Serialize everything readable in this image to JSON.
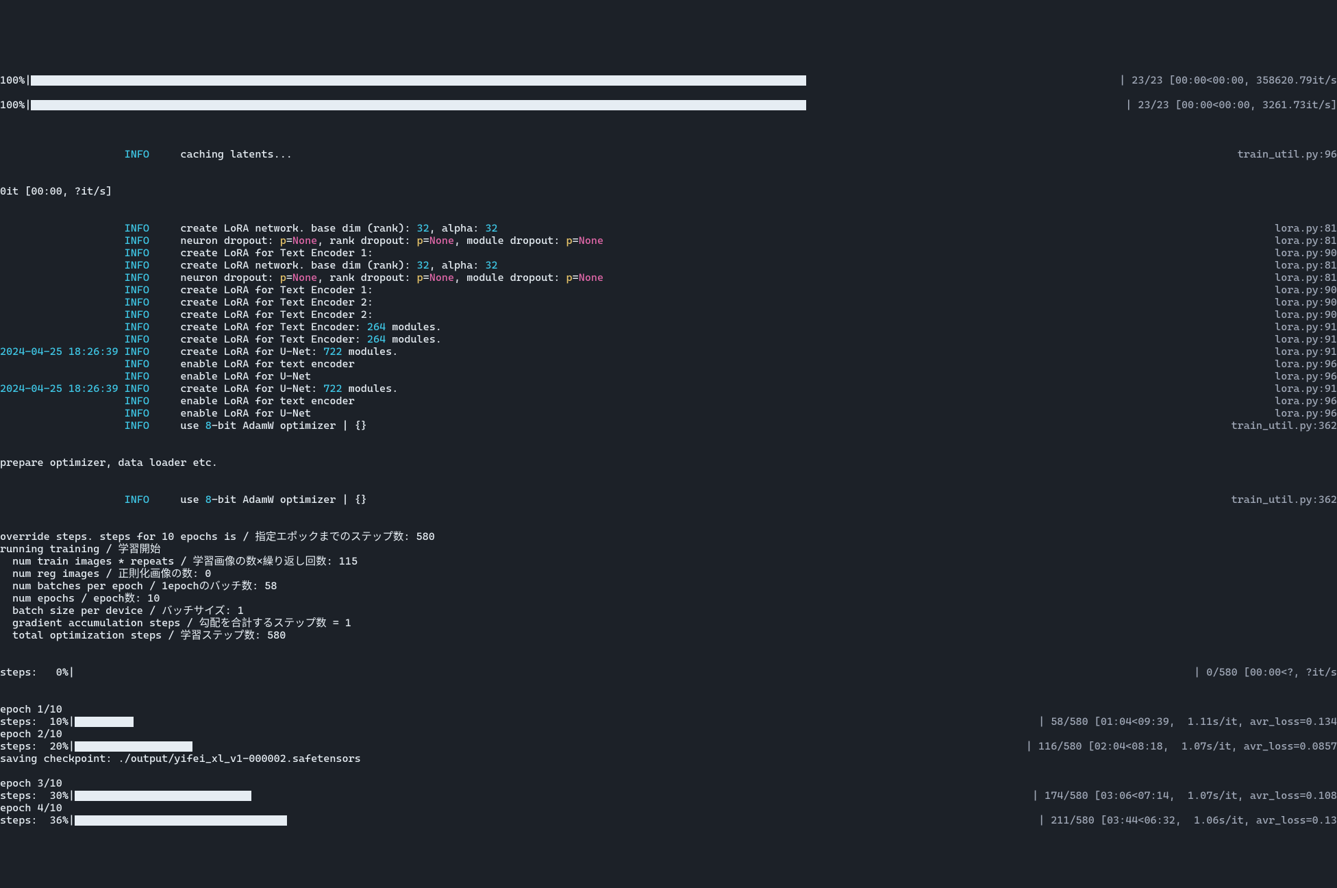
{
  "bars": {
    "b1": {
      "label": "100%|",
      "right": "| 23/23 [00:00<00:00, 358620.79it/s"
    },
    "b2": {
      "label": "100%|",
      "right": "| 23/23 [00:00<00:00, 3261.73it/s]"
    }
  },
  "log1": {
    "info": "INFO",
    "msg": "caching latents...",
    "right": "train_util.py:96"
  },
  "zeroit": "0it [00:00, ?it/s]",
  "rows": [
    {
      "ts": "",
      "info": "INFO",
      "msg": "create LoRA network. base dim (rank): ",
      "n1": "32",
      "mid": ", alpha: ",
      "n2": "32",
      "right": "lora.py:81"
    },
    {
      "ts": "",
      "info": "INFO",
      "msg": "neuron dropout: ",
      "right": "lora.py:81",
      "dropout": true
    },
    {
      "ts": "",
      "info": "INFO",
      "msg": "create LoRA for Text Encoder 1:",
      "right": "lora.py:90"
    },
    {
      "ts": "",
      "info": "INFO",
      "msg": "create LoRA network. base dim (rank): ",
      "n1": "32",
      "mid": ", alpha: ",
      "n2": "32",
      "right": "lora.py:81"
    },
    {
      "ts": "",
      "info": "INFO",
      "msg": "neuron dropout: ",
      "right": "lora.py:81",
      "dropout": true
    },
    {
      "ts": "",
      "info": "INFO",
      "msg": "create LoRA for Text Encoder 1:",
      "right": "lora.py:90"
    },
    {
      "ts": "",
      "info": "INFO",
      "msg": "create LoRA for Text Encoder 2:",
      "right": "lora.py:90"
    },
    {
      "ts": "",
      "info": "INFO",
      "msg": "create LoRA for Text Encoder 2:",
      "right": "lora.py:90"
    },
    {
      "ts": "",
      "info": "INFO",
      "msg": "create LoRA for Text Encoder: ",
      "n1": "264",
      "mid": " modules.",
      "right": "lora.py:91"
    },
    {
      "ts": "",
      "info": "INFO",
      "msg": "create LoRA for Text Encoder: ",
      "n1": "264",
      "mid": " modules.",
      "right": "lora.py:91"
    },
    {
      "ts": "2024-04-25 18:26:39",
      "info": "INFO",
      "msg": "create LoRA for U-Net: ",
      "n1": "722",
      "mid": " modules.",
      "right": "lora.py:91"
    },
    {
      "ts": "",
      "info": "INFO",
      "msg": "enable LoRA for text encoder",
      "right": "lora.py:96"
    },
    {
      "ts": "",
      "info": "INFO",
      "msg": "enable LoRA for U-Net",
      "right": "lora.py:96"
    },
    {
      "ts": "2024-04-25 18:26:39",
      "info": "INFO",
      "msg": "create LoRA for U-Net: ",
      "n1": "722",
      "mid": " modules.",
      "right": "lora.py:91"
    },
    {
      "ts": "",
      "info": "INFO",
      "msg": "enable LoRA for text encoder",
      "right": "lora.py:96"
    },
    {
      "ts": "",
      "info": "INFO",
      "msg": "enable LoRA for U-Net",
      "right": "lora.py:96"
    },
    {
      "ts": "",
      "info": "INFO",
      "msg_numprefix": "use ",
      "n1": "8",
      "msg_numsuffix": "-bit AdamW optimizer | {}",
      "right": "train_util.py:362"
    }
  ],
  "prep": "prepare optimizer, data loader etc.",
  "row_opt2": {
    "info": "INFO",
    "msg_numprefix": "use ",
    "n1": "8",
    "msg_numsuffix": "-bit AdamW optimizer | {}",
    "right": "train_util.py:362"
  },
  "plain": [
    "override steps. steps for 10 epochs is / 指定エポックまでのステップ数: 580",
    "running training / 学習開始",
    "  num train images * repeats / 学習画像の数×繰り返し回数: 115",
    "  num reg images / 正則化画像の数: 0",
    "  num batches per epoch / 1epochのバッチ数: 58",
    "  num epochs / epoch数: 10",
    "  batch size per device / バッチサイズ: 1",
    "  gradient accumulation steps / 勾配を合計するステップ数 = 1",
    "  total optimization steps / 学習ステップ数: 580"
  ],
  "steps0": {
    "label": "steps:   0%|",
    "right": "| 0/580 [00:00<?, ?it/s"
  },
  "dropout": {
    "p": "p",
    "eq": "=",
    "none": "None",
    "sep1": ", rank dropout: ",
    "sep2": ", module dropout: "
  },
  "progress": [
    {
      "epoch": "epoch 1/10",
      "label": "steps:  10%|",
      "width": "bar-10",
      "right": "| 58/580 [01:04<09:39,  1.11s/it, avr_loss=0.134"
    },
    {
      "epoch": "epoch 2/10",
      "label": "steps:  20%|",
      "width": "bar-20",
      "right": "| 116/580 [02:04<08:18,  1.07s/it, avr_loss=0.0857"
    },
    {
      "checkpoint": "saving checkpoint: ./output/yifei_xl_v1-000002.safetensors"
    },
    {
      "blank": true
    },
    {
      "epoch": "epoch 3/10",
      "label": "steps:  30%|",
      "width": "bar-30",
      "right": "| 174/580 [03:06<07:14,  1.07s/it, avr_loss=0.108"
    },
    {
      "epoch": "epoch 4/10",
      "label": "steps:  36%|",
      "width": "bar-36",
      "right": "| 211/580 [03:44<06:32,  1.06s/it, avr_loss=0.13"
    }
  ],
  "pad": {
    "ts19": "                   ",
    "gap5": "     "
  }
}
